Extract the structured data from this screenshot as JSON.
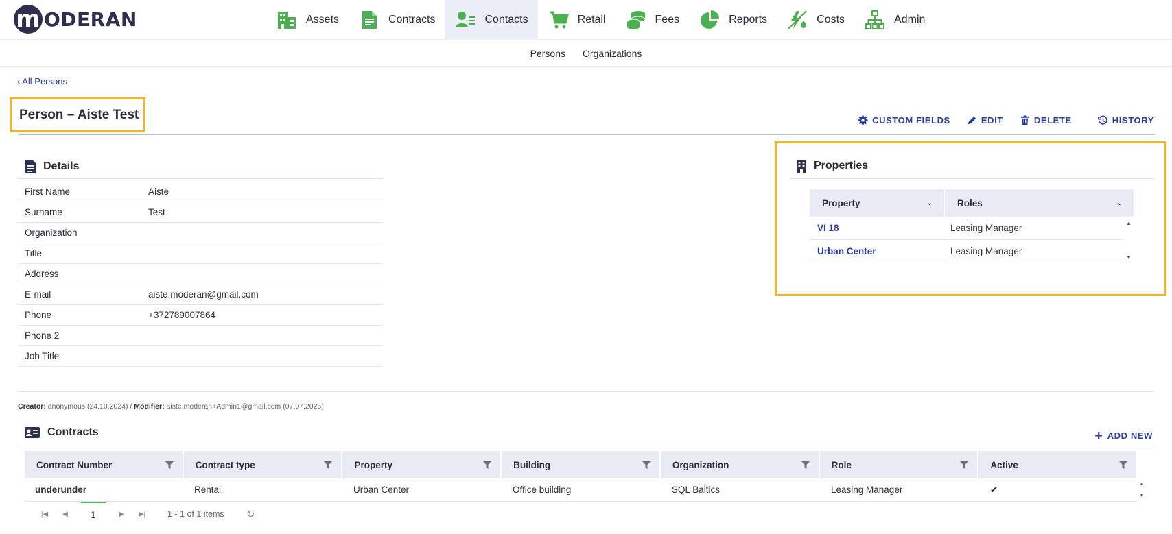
{
  "brand": {
    "logo_letter": "m",
    "logo_text": "ODERAN"
  },
  "nav": {
    "items": [
      {
        "label": "Assets",
        "icon": "building-icon"
      },
      {
        "label": "Contracts",
        "icon": "document-icon"
      },
      {
        "label": "Contacts",
        "icon": "contact-card-icon",
        "active": true
      },
      {
        "label": "Retail",
        "icon": "cart-icon"
      },
      {
        "label": "Fees",
        "icon": "coins-icon"
      },
      {
        "label": "Reports",
        "icon": "pie-chart-icon"
      },
      {
        "label": "Costs",
        "icon": "energy-icon"
      },
      {
        "label": "Admin",
        "icon": "org-chart-icon"
      }
    ]
  },
  "subnav": {
    "items": [
      "Persons",
      "Organizations"
    ]
  },
  "breadcrumb": "‹  All Persons",
  "page": {
    "title": "Person – Aiste Test"
  },
  "actions": {
    "custom_fields": "CUSTOM FIELDS",
    "edit": "EDIT",
    "delete": "DELETE",
    "history": "HISTORY"
  },
  "details": {
    "title": "Details",
    "rows": [
      {
        "label": "First Name",
        "value": "Aiste"
      },
      {
        "label": "Surname",
        "value": "Test"
      },
      {
        "label": "Organization",
        "value": ""
      },
      {
        "label": "Title",
        "value": ""
      },
      {
        "label": "Address",
        "value": ""
      },
      {
        "label": "E-mail",
        "value": "aiste.moderan@gmail.com",
        "link": true
      },
      {
        "label": "Phone",
        "value": "+372789007864"
      },
      {
        "label": "Phone 2",
        "value": ""
      },
      {
        "label": "Job Title",
        "value": ""
      }
    ]
  },
  "properties": {
    "title": "Properties",
    "columns": [
      "Property",
      "Roles"
    ],
    "rows": [
      {
        "property": "VI 18",
        "role": "Leasing Manager"
      },
      {
        "property": "Urban Center",
        "role": "Leasing Manager"
      }
    ]
  },
  "meta": {
    "creator_label": "Creator:",
    "creator_value": "anonymous (24.10.2024)",
    "separator": " / ",
    "modifier_label": "Modifier:",
    "modifier_value": "aiste.moderan+Admin1@gmail.com (07.07.2025)"
  },
  "contracts": {
    "title": "Contracts",
    "add_new": "ADD NEW",
    "columns": [
      "Contract Number",
      "Contract type",
      "Property",
      "Building",
      "Organization",
      "Role",
      "Active"
    ],
    "rows": [
      {
        "number": "underunder",
        "type": "Rental",
        "property": "Urban Center",
        "building": "Office building",
        "organization": "SQL Baltics",
        "role": "Leasing Manager",
        "active": "✔"
      }
    ],
    "pager": {
      "page": "1",
      "info": "1 - 1 of 1 items"
    }
  },
  "colors": {
    "accent": "#2a3d9e",
    "icon_green": "#4caf50",
    "highlight": "#f0b429"
  }
}
